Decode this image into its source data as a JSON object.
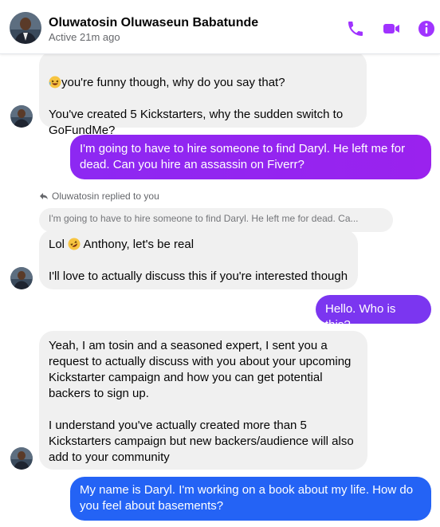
{
  "header": {
    "name": "Oluwatosin Oluwaseun Babatunde",
    "status": "Active 21m ago",
    "icons": [
      "phone-icon",
      "video-icon",
      "info-icon"
    ],
    "accent_color": "#a033ff"
  },
  "messages": [
    {
      "side": "in",
      "text": "you're funny though, why do you say that?\n\nYou've created 5 Kickstarters, why the sudden switch to GoFundMe?",
      "emoji": "laughing-face"
    },
    {
      "side": "out",
      "text": "I'm going to have to hire someone to find Daryl. He left me for dead. Can you hire an assassin on Fiverr?"
    },
    {
      "side": "in",
      "reply_note": "Oluwatosin replied to you",
      "quoted": "I'm going to have to hire someone to find Daryl. He left me for dead. Ca...",
      "text_before": "Lol",
      "text_after": " Anthony, let's be real\n\nI'll love to actually discuss this if you're interested though",
      "emoji": "rofl-face"
    },
    {
      "side": "out",
      "text": "Hello. Who is this?"
    },
    {
      "side": "in",
      "text": "Yeah, I am tosin and a seasoned expert, I sent you a request to actually discuss with you about your upcoming Kickstarter campaign and how you can get potential backers to sign up.\n\nI understand you've actually created more than 5 Kickstarters campaign but new backers/audience will also add to your community"
    },
    {
      "side": "out",
      "text": "My name is Daryl. I'm working on a book about my life. How do you feel about basements?"
    }
  ]
}
